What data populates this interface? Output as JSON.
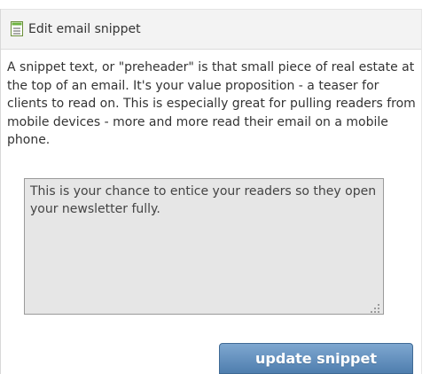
{
  "header": {
    "icon": "document-icon",
    "title": "Edit email snippet"
  },
  "description": "A snippet text, or \"preheader\" is that small piece of real estate at the top of an email. It's your value proposition - a teaser for clients to read on. This is especially great for pulling readers from mobile devices - more and more read their email on a mobile phone.",
  "snippet": {
    "value": "This is your chance to entice your readers so they open your newsletter fully."
  },
  "button": {
    "label": "update snippet"
  },
  "colors": {
    "accent": "#5b87b6",
    "icon_green": "#6db33f"
  }
}
